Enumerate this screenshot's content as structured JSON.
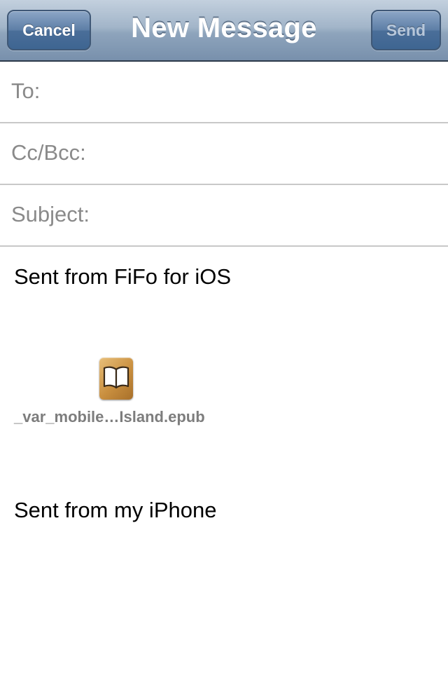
{
  "navbar": {
    "title": "New Message",
    "cancel_label": "Cancel",
    "send_label": "Send",
    "send_enabled": false
  },
  "fields": {
    "to_label": "To:",
    "to_value": "",
    "ccbcc_label": "Cc/Bcc:",
    "ccbcc_value": "",
    "subject_label": "Subject:",
    "subject_value": ""
  },
  "body": {
    "line1": "Sent from FiFo for iOS",
    "attachment": {
      "icon": "book-icon",
      "filename": "_var_mobile…Island.epub"
    },
    "signature": "Sent from my iPhone"
  },
  "colors": {
    "navbar_gradient_top": "#c3d0de",
    "navbar_gradient_bottom": "#7890ac",
    "button_blue": "#4a6e99",
    "label_gray": "#8a8a8a",
    "attachment_text_gray": "#7d7d7d",
    "divider_gray": "#c8c8c8"
  }
}
